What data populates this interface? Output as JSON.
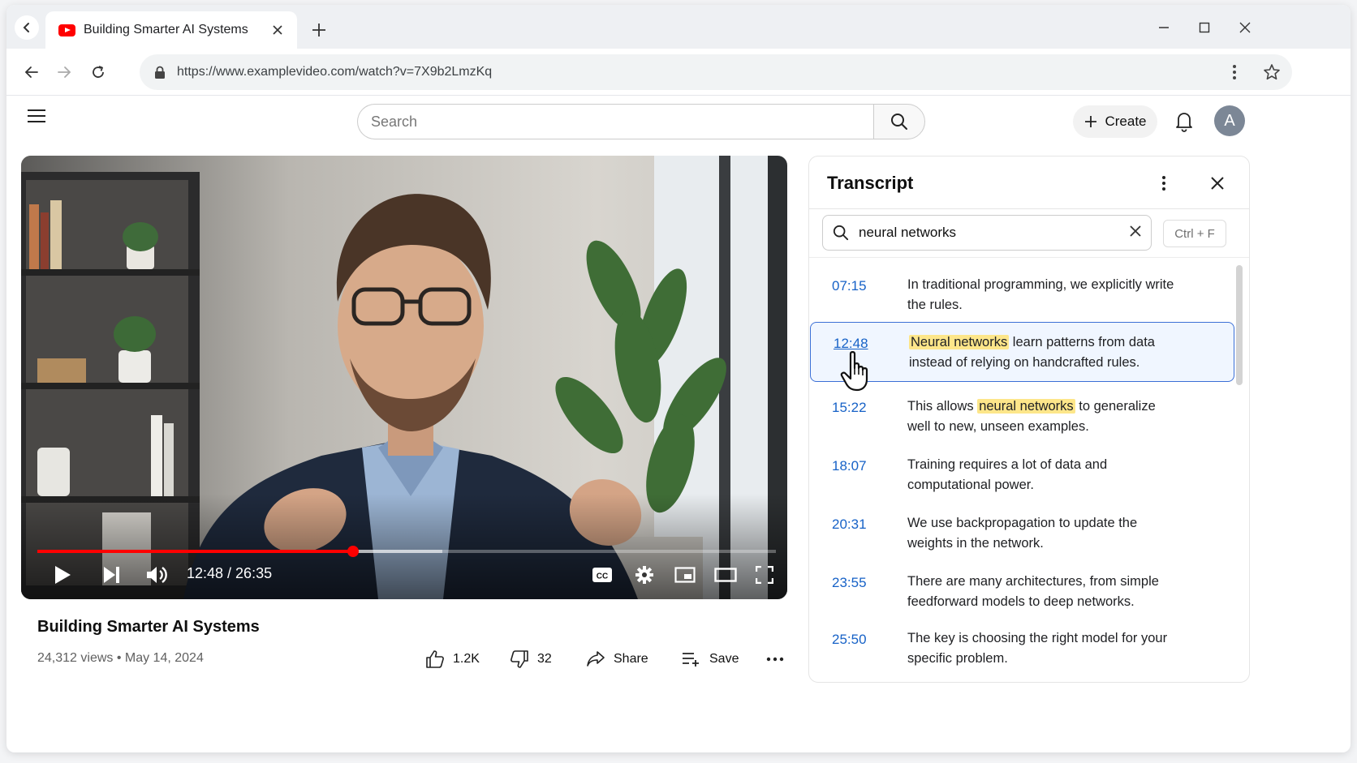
{
  "browser": {
    "tab_title": "Building Smarter AI Systems",
    "url": "https://www.examplevideo.com/watch?v=7X9b2LmzKq"
  },
  "header": {
    "search_placeholder": "Search",
    "create_label": "Create",
    "avatar_initial": "A"
  },
  "player": {
    "time_display": "12:48 / 26:35",
    "progress_fraction": 0.427,
    "buffered_fraction": 0.548
  },
  "video": {
    "title": "Building Smarter AI Systems",
    "meta": "24,312 views • May 14, 2024",
    "likes": "1.2K",
    "dislikes": "32",
    "share_label": "Share",
    "save_label": "Save"
  },
  "transcript": {
    "title": "Transcript",
    "search_value": "neural networks",
    "shortcut": "Ctrl + F",
    "segments": [
      {
        "time": "07:15",
        "parts": [
          {
            "t": "In traditional programming, we explicitly write the rules."
          }
        ]
      },
      {
        "time": "12:48",
        "active": true,
        "parts": [
          {
            "t": "Neural networks",
            "hl": true
          },
          {
            "t": " learn patterns from data instead of relying on handcrafted rules."
          }
        ]
      },
      {
        "time": "15:22",
        "parts": [
          {
            "t": "This allows "
          },
          {
            "t": "neural networks",
            "hl": true
          },
          {
            "t": " to generalize well to new, unseen examples."
          }
        ]
      },
      {
        "time": "18:07",
        "parts": [
          {
            "t": "Training requires a lot of data and computational power."
          }
        ]
      },
      {
        "time": "20:31",
        "parts": [
          {
            "t": "We use backpropagation to update the weights in the network."
          }
        ]
      },
      {
        "time": "23:55",
        "parts": [
          {
            "t": "There are many architectures, from simple feedforward models to deep networks."
          }
        ]
      },
      {
        "time": "25:50",
        "parts": [
          {
            "t": "The key is choosing the right model for your specific problem."
          }
        ]
      }
    ]
  }
}
